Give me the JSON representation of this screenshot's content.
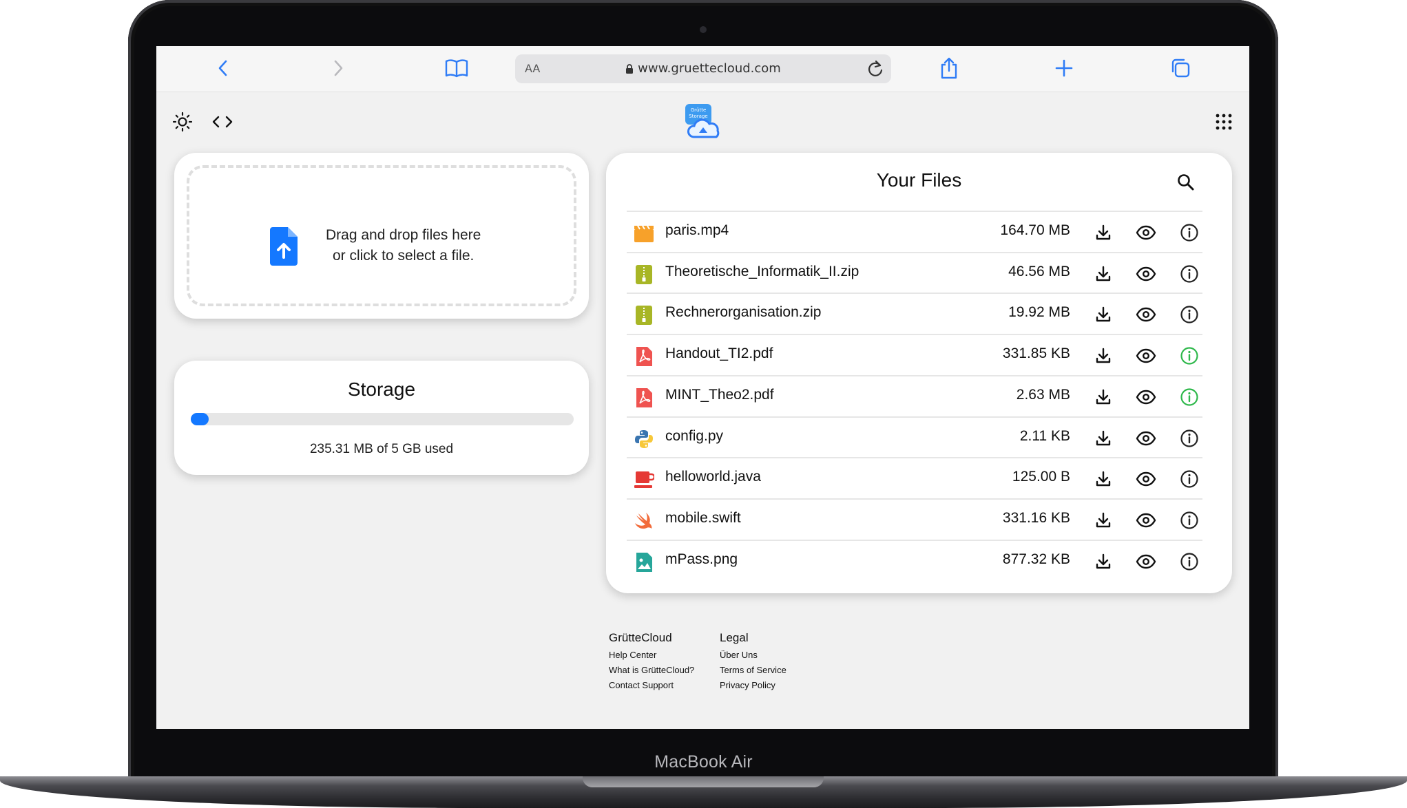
{
  "browser": {
    "aa_label": "AA",
    "url": "www.gruettecloud.com"
  },
  "app": {
    "logo_text_line1": "Grütte",
    "logo_text_line2": "Storage"
  },
  "upload": {
    "line1": "Drag and drop files here",
    "line2": "or click to select a file."
  },
  "storage": {
    "title": "Storage",
    "used_fraction": 0.046,
    "usage_text": "235.31 MB of 5 GB used"
  },
  "files": {
    "title": "Your Files",
    "items": [
      {
        "name": "paris.mp4",
        "size": "164.70 MB",
        "icon": "video-clapper-icon",
        "info_color": "#222222"
      },
      {
        "name": "Theoretische_Informatik_II.zip",
        "size": "46.56 MB",
        "icon": "zip-archive-icon",
        "info_color": "#222222"
      },
      {
        "name": "Rechnerorganisation.zip",
        "size": "19.92 MB",
        "icon": "zip-archive-icon",
        "info_color": "#222222"
      },
      {
        "name": "Handout_TI2.pdf",
        "size": "331.85 KB",
        "icon": "pdf-icon",
        "info_color": "#2eb84b"
      },
      {
        "name": "MINT_Theo2.pdf",
        "size": "2.63 MB",
        "icon": "pdf-icon",
        "info_color": "#2eb84b"
      },
      {
        "name": "config.py",
        "size": "2.11 KB",
        "icon": "python-icon",
        "info_color": "#222222"
      },
      {
        "name": "helloworld.java",
        "size": "125.00 B",
        "icon": "java-cup-icon",
        "info_color": "#222222"
      },
      {
        "name": "mobile.swift",
        "size": "331.16 KB",
        "icon": "swift-icon",
        "info_color": "#222222"
      },
      {
        "name": "mPass.png",
        "size": "877.32 KB",
        "icon": "image-file-icon",
        "info_color": "#222222"
      }
    ]
  },
  "footer": {
    "col1": {
      "heading": "GrütteCloud",
      "links": [
        "Help Center",
        "What is GrütteCloud?",
        "Contact Support"
      ]
    },
    "col2": {
      "heading": "Legal",
      "links": [
        "Über Uns",
        "Terms of Service",
        "Privacy Policy"
      ]
    }
  },
  "device": {
    "label": "MacBook Air"
  },
  "colors": {
    "accent": "#1478ff",
    "safari_blue": "#2f7cf6",
    "success": "#2eb84b"
  }
}
